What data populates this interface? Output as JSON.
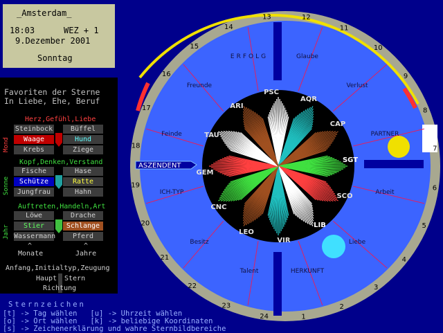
{
  "info": {
    "city": "_Amsterdam_",
    "time": "18:03",
    "tz": "WEZ + 1",
    "date": "9.Dezember 2001",
    "weekday": "Sonntag"
  },
  "fav": {
    "title1": "Favoriten der Sterne",
    "title2": "In Liebe, Ehe, Beruf",
    "sec1": "Herz,Gefühl,Liebe",
    "sec1_side": "Mond",
    "sec1_left": [
      "Steinbock",
      "Waage",
      "Krebs"
    ],
    "sec1_right": [
      "Büffel",
      "Hund",
      "Ziege"
    ],
    "sec2": "Kopf,Denken,Verstand",
    "sec2_side": "Sonne",
    "sec2_left": [
      "Fische",
      "Schütze",
      "Jungfrau"
    ],
    "sec2_right": [
      "Hase",
      "Ratte",
      "Hahn"
    ],
    "sec3": "Auftreten,Handeln,Art",
    "sec3_side": "Jahr",
    "sec3_left": [
      "Löwe",
      "Stier",
      "Wassermann"
    ],
    "sec3_right": [
      "Drache",
      "Schlange",
      "Pferd"
    ],
    "caret": "^",
    "monate": "Monate",
    "jahre": "Jahre",
    "anfang": "Anfang,Initialtyp,Zeugung",
    "haupt": "Haupt",
    "stern": "Stern",
    "richtung": "Richtung"
  },
  "help": {
    "title": "Sternzeichen",
    "line1": "[t] -> Tag wählen   [u] -> Uhrzeit wählen",
    "line2": "[o] -> Ort wählen   [k] -> beliebige Koordinaten",
    "line3": "[s] -> Zeichenerklärung und wahre Sternbildbereiche"
  },
  "wheel": {
    "hours": [
      "1",
      "2",
      "3",
      "4",
      "5",
      "6",
      "7",
      "8",
      "9",
      "10",
      "11",
      "12",
      "13",
      "14",
      "15",
      "16",
      "17",
      "18",
      "19",
      "20",
      "21",
      "22",
      "23",
      "24"
    ],
    "houses": [
      "ERFOLG",
      "Glaube",
      "Verlust",
      "PARTNER",
      "Arbeit",
      "Liebe",
      "HERKUNFT",
      "Talent",
      "Besitz",
      "ICH-TYP",
      "Feinde",
      "Freunde"
    ],
    "signs": [
      "PSC",
      "AQR",
      "CAP",
      "SGT",
      "SCO",
      "LIB",
      "VIR",
      "LEO",
      "CNC",
      "GEM",
      "TAU",
      "ARI"
    ],
    "aszendent": "ASZENDENT"
  },
  "colors": {
    "bg": "#00008b",
    "disc": "#3c64ff",
    "ring": "#a8a890",
    "sun": "#f0e000",
    "moon": "#40e0ff"
  }
}
